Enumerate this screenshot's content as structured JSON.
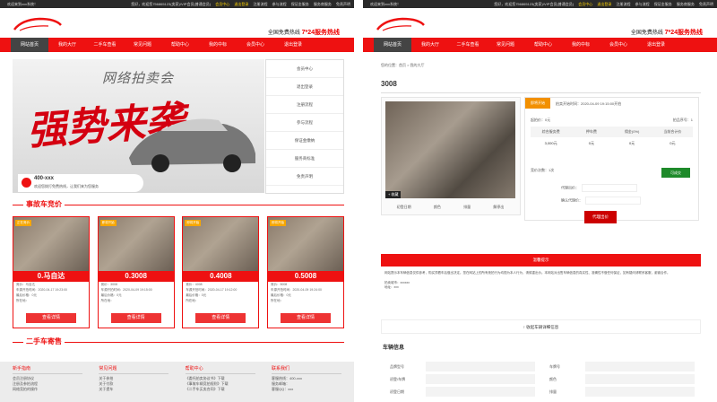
{
  "site": {
    "top_welcome": "欢迎来到xxx系统！",
    "top_notice": "您好，欢迎您756865123(卖家)/VIP会员(普通会员)",
    "top_links": [
      "会员中心",
      "退出登录",
      "注册流程",
      "参与流程",
      "保证金服务",
      "服务商服务",
      "免责声明"
    ],
    "hotline_label": "全国免费热线",
    "hotline_value": "7*24服务热线",
    "nav": [
      "网站首页",
      "我的大厅",
      "二手车查看",
      "常见问题",
      "帮助中心",
      "我的中标",
      "会员中心",
      "退出登录"
    ]
  },
  "left": {
    "banner_title": "网络拍卖会",
    "banner_slogan": "强势来袭",
    "banner_phone": "400-xxx",
    "banner_phone_desc": "欢迎您拨打免费热线，让我们来为您服务",
    "side_menu": [
      "会员中心",
      "退出登录",
      "注册流程",
      "参与流程",
      "保证金缴纳",
      "服务商标准",
      "免责声明"
    ],
    "section_accident": "事故车竞价",
    "section_used": "二手车寄售",
    "cards": [
      {
        "tag": "正在竞价",
        "price": "0.马自达",
        "l1": "竞价：马自达",
        "l2": "车源开拍时间：2020-04-17 19:23:00",
        "l3": "最后价格：0元",
        "l4": "所在地：",
        "btn": "查看详情"
      },
      {
        "tag": "即将开始",
        "price": "0.3008",
        "l1": "竞价：3008",
        "l2": "车源开拍时间：2020-04-09 19:15:00",
        "l3": "最后价格：0元",
        "l4": "所在地：",
        "btn": "查看详情"
      },
      {
        "tag": "即将开始",
        "price": "0.4008",
        "l1": "竞价：4008",
        "l2": "车源开拍时间：2020-04-17 19:12:00",
        "l3": "最后价格：0元",
        "l4": "所在地：",
        "btn": "查看详情"
      },
      {
        "tag": "即将开始",
        "price": "0.5008",
        "l1": "竞价：5008",
        "l2": "车源开拍时间：2020-04-09 19:24:00",
        "l3": "最后价格：0元",
        "l4": "所在地：",
        "btn": "查看详情"
      }
    ],
    "footer": [
      {
        "h": "新手指南",
        "items": [
          "会员注册协议",
          "注册及参拍流程",
          "网络竞拍的操作"
        ]
      },
      {
        "h": "常见问题",
        "items": [
          "关于参拍",
          "关于付款",
          "关于提车"
        ]
      },
      {
        "h": "帮助中心",
        "items": [
          "《委托拍卖协议书》下载",
          "《事故车辆竞拍规则》下载",
          "《二手车买卖合同》下载"
        ]
      },
      {
        "h": "联系我们",
        "items": [
          "客服热线：400-xxx",
          "服务邮箱：",
          "客服QQ：xxx"
        ]
      }
    ]
  },
  "right": {
    "breadcrumb": "您的位置：首页 > 我的大厅",
    "title": "3008",
    "fav": "+ 收藏",
    "thumbs": [
      "初登日期",
      "颜色",
      "排量",
      "解停出"
    ],
    "status": "即将开始",
    "status_time": "拍卖开始时间：2020-04-09 19:15:00开拍",
    "start_price_label": "起拍价：",
    "start_price": "0元",
    "lot_label": "拍品序号：",
    "lot": "1",
    "fee_headers": [
      "综合服务费",
      "押车费",
      "佣金(0%)",
      "当前合计价"
    ],
    "fee_values": [
      "3,000元",
      "0元",
      "0元",
      "0元"
    ],
    "bid_count": "竞价次数：1次",
    "confirm_btn": "可成交",
    "proxy_price_label": "代理出价：",
    "confirm_price_label": "确认代理价：",
    "bid_btn": "代理出价",
    "tab": "温馨提示",
    "desc1": "网站提示本车辆信息仅供参考，购买须看车后做出决定。您在网站上的所有竞拍行为均视为本人行为，请慎重出价。本网站对出售车辆信息的真实性、准确性不做任何保证，如有疑问请联系客服，谢谢合作。",
    "desc2": "拍卖城市：xxxxxx",
    "desc3": "地址：xxx",
    "expand": "收起车辆详细信息",
    "vinfo_title": "车辆信息",
    "vinfo_rows": [
      [
        "品牌型号",
        "车牌号"
      ],
      [
        "初登/车牌",
        "颜色"
      ],
      [
        "初登日期",
        "排量"
      ]
    ]
  },
  "colors": {
    "brand_red": "#e11111",
    "nav_active": "#444444",
    "status_orange": "#f29000",
    "confirm_green": "#1e8a2a"
  }
}
